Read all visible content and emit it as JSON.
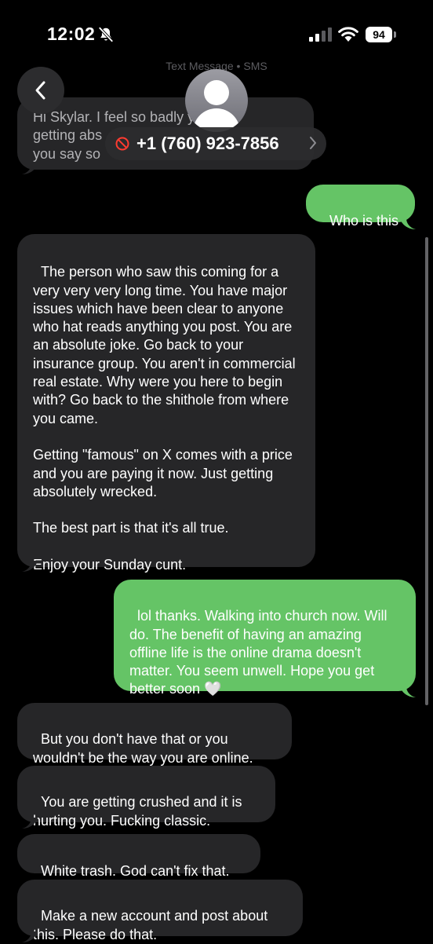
{
  "status_bar": {
    "time": "12:02",
    "battery": "94",
    "icons": [
      "bell-slash-icon",
      "cellular-signal-icon",
      "wifi-icon",
      "battery-icon"
    ]
  },
  "header": {
    "service_label": "Text Message • SMS",
    "contact_number": "+1 (760) 923-7856",
    "icons": [
      "back-chevron-icon",
      "contact-avatar-icon",
      "blocked-icon",
      "chevron-right-icon"
    ]
  },
  "colors": {
    "background": "#000000",
    "incoming_bubble": "#262628",
    "outgoing_bubble": "#65c466",
    "header_pill": "#2c2c2e"
  },
  "messages": [
    {
      "direction": "incoming",
      "partial": true,
      "text": "Hi Skylar. I feel so badly you're\ngetting abs\nyou say so"
    },
    {
      "direction": "outgoing",
      "text": "Who is this"
    },
    {
      "direction": "incoming",
      "text": "The person who saw this coming for a very very very long time. You have major issues which have been clear to anyone who hat reads anything you post. You are an absolute joke. Go back to your insurance group. You aren't in commercial real estate. Why were you here to begin with? Go back to the shithole from where you came.\n\nGetting \"famous\" on X comes with a price and you are paying it now. Just getting absolutely wrecked.\n\nThe best part is that it's all true.\n\nEnjoy your Sunday cunt."
    },
    {
      "direction": "outgoing",
      "text": "lol thanks. Walking into church now. Will do. The benefit of having an amazing offline life is the online drama doesn't matter. You seem unwell. Hope you get better soon 🤍"
    },
    {
      "direction": "incoming",
      "text": "But you don't have that or you wouldn't be the way you are online."
    },
    {
      "direction": "incoming",
      "text": "You are getting crushed and it is hurting you. Fucking classic."
    },
    {
      "direction": "incoming",
      "text": "White trash. God can't fix that."
    },
    {
      "direction": "incoming",
      "text": "Make a new account and post about this. Please do that."
    }
  ]
}
